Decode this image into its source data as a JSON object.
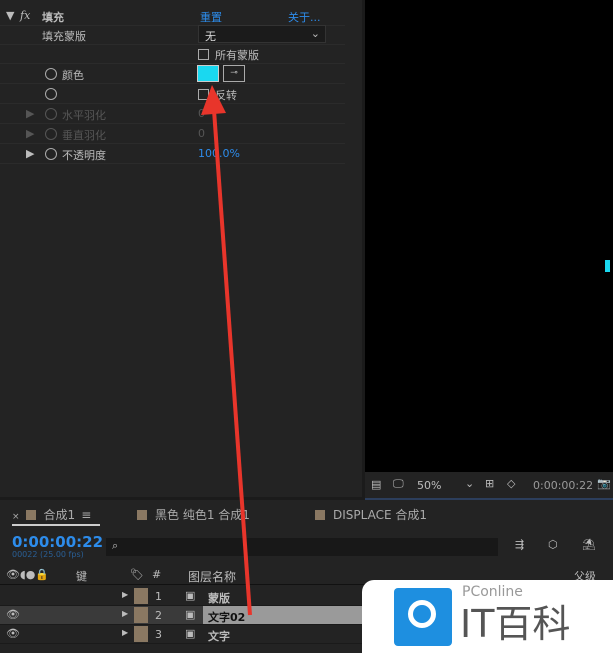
{
  "effect": {
    "name": "填充",
    "reset": "重置",
    "about": "关于...",
    "props": [
      {
        "label": "填充蒙版",
        "value": "无"
      },
      {
        "label": "",
        "value": "所有蒙版"
      },
      {
        "label": "颜色",
        "color": "#1ad8f0"
      },
      {
        "label": "",
        "value": "反转"
      },
      {
        "label": "水平羽化",
        "value": "0"
      },
      {
        "label": "垂直羽化",
        "value": "0"
      },
      {
        "label": "不透明度",
        "value": "100.0%"
      }
    ]
  },
  "viewer": {
    "zoom": "50%",
    "timecode": "0:00:00:22"
  },
  "timeline": {
    "tabs": [
      "合成1",
      "黑色 纯色1 合成1",
      "DISPLACE 合成1"
    ],
    "timecode": "0:00:00:22",
    "frames": "00022 (25.00 fps)",
    "headers": {
      "key": "键",
      "num": "#",
      "name": "图层名称",
      "parent": "父级"
    },
    "layers": [
      {
        "num": "1",
        "name": "蒙版"
      },
      {
        "num": "2",
        "name": "文字02"
      },
      {
        "num": "3",
        "name": "文字"
      }
    ]
  },
  "watermark": {
    "brand": "PConline",
    "title": "IT百科"
  }
}
